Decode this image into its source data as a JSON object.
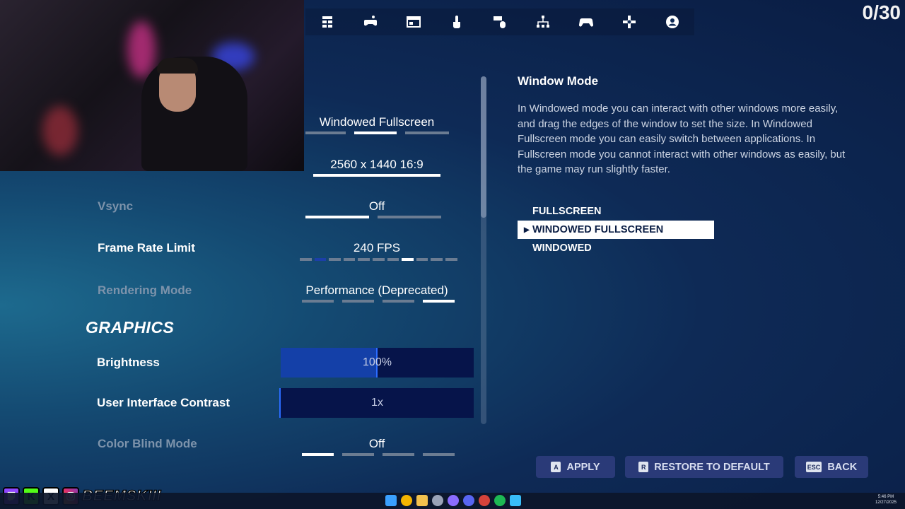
{
  "counter": "0/30",
  "topbar": {
    "tabs": [
      {
        "icon": "game-settings-icon"
      },
      {
        "icon": "controller-settings-icon"
      },
      {
        "icon": "display-icon"
      },
      {
        "icon": "touch-icon"
      },
      {
        "icon": "keyboard-mouse-icon"
      },
      {
        "icon": "hierarchy-icon"
      },
      {
        "icon": "gamepad-icon"
      },
      {
        "icon": "dpad-icon"
      },
      {
        "icon": "account-icon"
      }
    ]
  },
  "settings": {
    "window_mode": {
      "value": "Windowed Fullscreen",
      "options_count": 3,
      "selected_index": 1
    },
    "resolution": {
      "value": "2560 x 1440 16:9"
    },
    "vsync": {
      "label": "Vsync",
      "value": "Off",
      "selected_index": 0,
      "options_count": 2
    },
    "frame_rate": {
      "label": "Frame Rate Limit",
      "value": "240 FPS",
      "options_count": 11,
      "selected_index": 7
    },
    "rendering_mode": {
      "label": "Rendering Mode",
      "value": "Performance (Deprecated)",
      "options_count": 4,
      "selected_index": 3
    },
    "section_graphics": "GRAPHICS",
    "brightness": {
      "label": "Brightness",
      "value": "100%",
      "fraction": 0.5
    },
    "ui_contrast": {
      "label": "User Interface Contrast",
      "value": "1x",
      "fraction": 0.0
    },
    "color_blind": {
      "label": "Color Blind Mode",
      "value": "Off",
      "options_count": 4,
      "selected_index": 0
    }
  },
  "detail": {
    "title": "Window Mode",
    "description": "In Windowed mode you can interact with other windows more easily, and drag the edges of the window to set the size. In Windowed Fullscreen mode you can easily switch between applications. In Fullscreen mode you cannot interact with other windows as easily, but the game may run slightly faster.",
    "options": [
      "FULLSCREEN",
      "WINDOWED FULLSCREEN",
      "WINDOWED"
    ],
    "selected": "WINDOWED FULLSCREEN"
  },
  "buttons": {
    "apply": {
      "key": "A",
      "label": "APPLY"
    },
    "restore": {
      "key": "R",
      "label": "RESTORE TO DEFAULT"
    },
    "back": {
      "key": "ESC",
      "label": "BACK"
    }
  },
  "socials": {
    "handle": "BEEMSKIII"
  },
  "clock": {
    "time": "5:46 PM",
    "date": "12/27/2025"
  },
  "colors": {
    "accent": "#1440a8",
    "slider_bg": "#06144a",
    "button_bg": "#2a3a78"
  }
}
